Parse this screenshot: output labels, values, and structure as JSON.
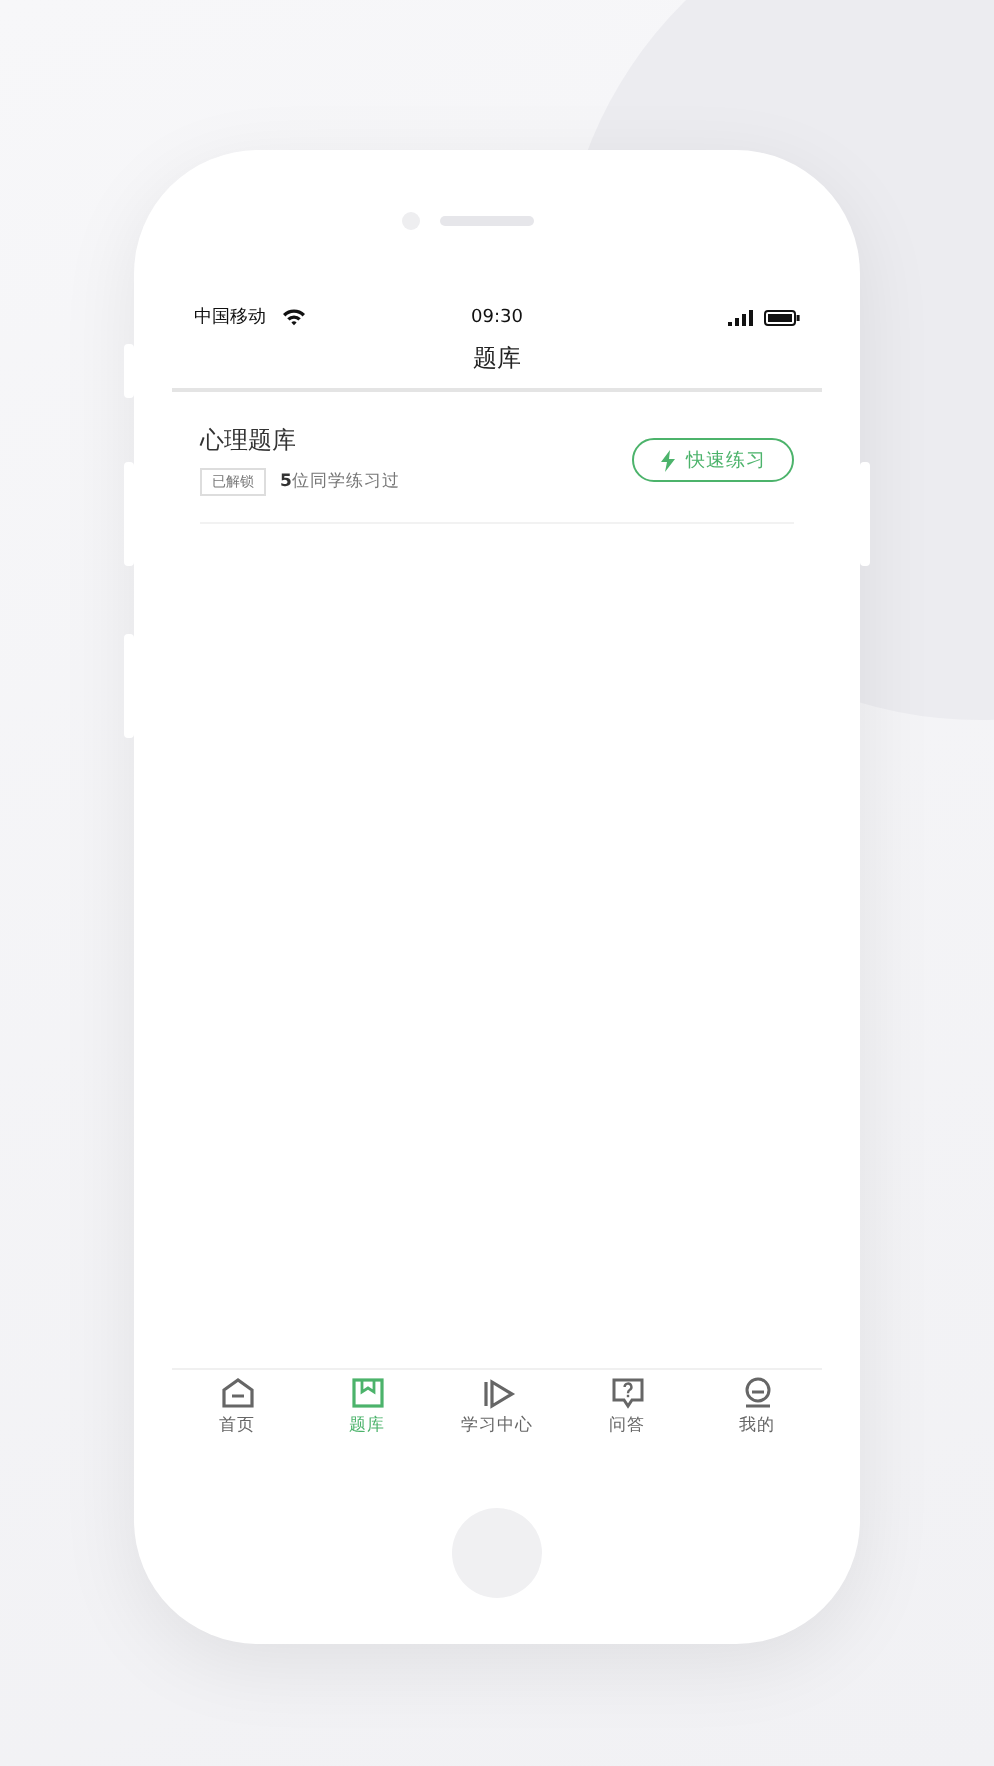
{
  "status_bar": {
    "carrier": "中国移动",
    "time": "09:30"
  },
  "nav": {
    "title": "题库"
  },
  "banks": [
    {
      "title": "心理题库",
      "tag": "已解锁",
      "stat": "**5**位同学练习过",
      "action": "快速练习"
    }
  ],
  "tab_bar": [
    {
      "label": "首页",
      "selected": false
    },
    {
      "label": "题库",
      "selected": true
    },
    {
      "label": "学习中心",
      "selected": false
    },
    {
      "label": "问答",
      "selected": false
    },
    {
      "label": "我的",
      "selected": false
    }
  ]
}
